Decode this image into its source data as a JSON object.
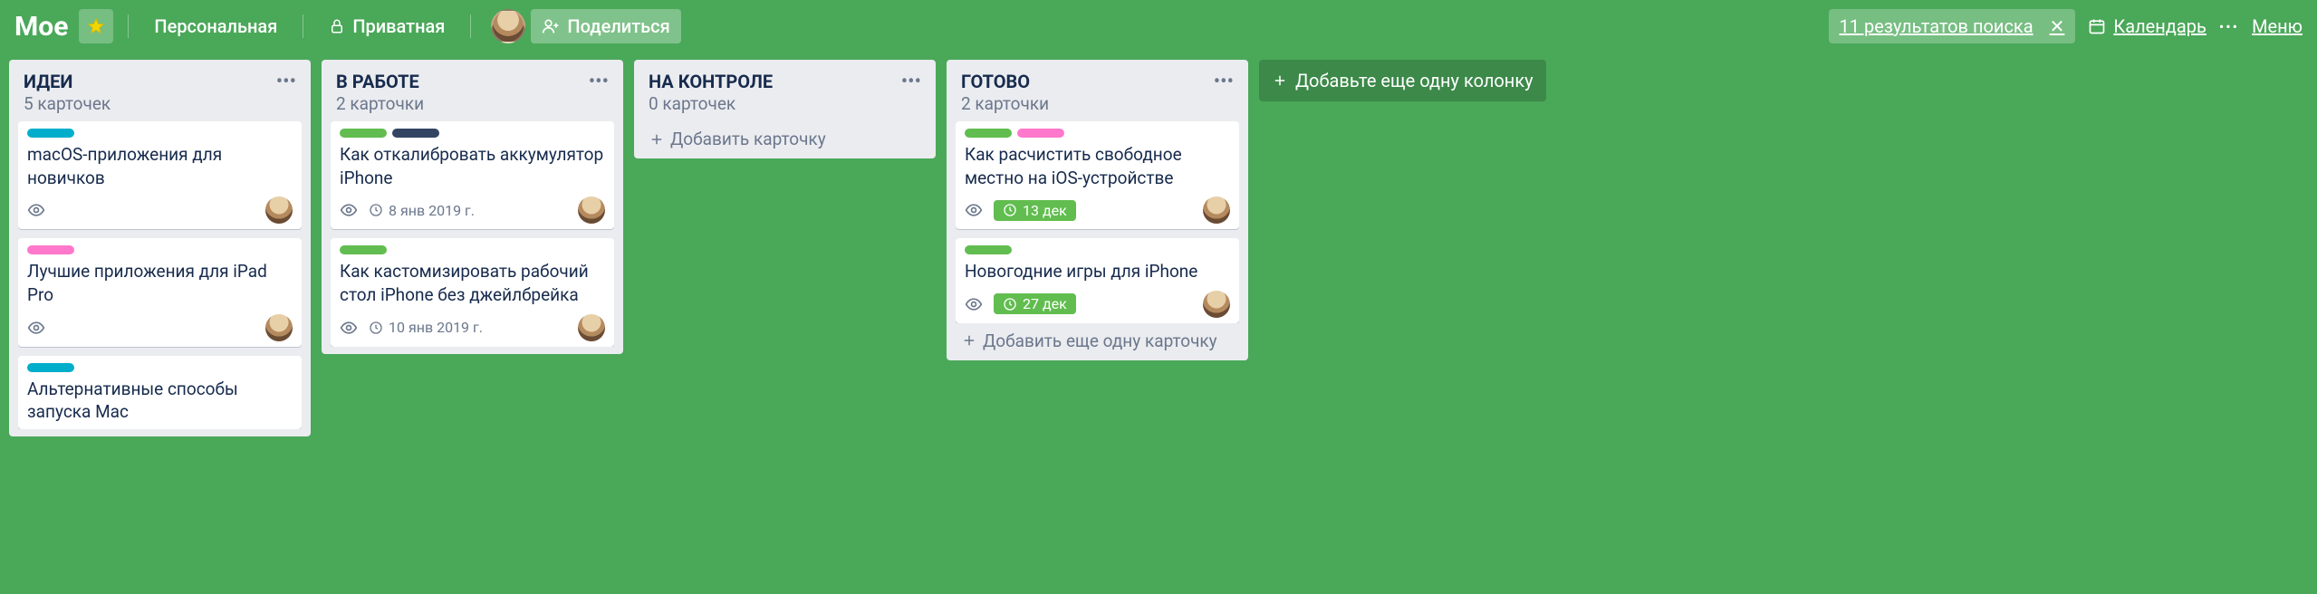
{
  "header": {
    "board_title": "Мое",
    "team_label": "Персональная",
    "visibility_label": "Приватная",
    "share_label": "Поделиться",
    "search_results_label": "11 результатов поиска",
    "calendar_label": "Календарь",
    "menu_label": "Меню"
  },
  "label_colors": {
    "blue": "#00aecc",
    "green": "#61bd4f",
    "pink": "#ff78cb",
    "dark": "#344563"
  },
  "lists": [
    {
      "title": "ИДЕИ",
      "count_label": "5 карточек",
      "add_card_label": "",
      "cards": [
        {
          "labels": [
            "blue"
          ],
          "title": "macOS-приложения для новичков",
          "watch": true,
          "due": null,
          "member": true
        },
        {
          "labels": [
            "pink"
          ],
          "title": "Лучшие приложения для iPad Pro",
          "watch": true,
          "due": null,
          "member": true
        },
        {
          "labels": [
            "blue"
          ],
          "title": "Альтернативные способы запуска Mac",
          "watch": false,
          "due": null,
          "member": false
        }
      ]
    },
    {
      "title": "В РАБОТЕ",
      "count_label": "2 карточки",
      "add_card_label": "",
      "cards": [
        {
          "labels": [
            "green",
            "dark"
          ],
          "title": "Как откалибровать аккумулятор iPhone",
          "watch": true,
          "due": "8 янв 2019 г.",
          "due_style": "plain",
          "member": true
        },
        {
          "labels": [
            "green"
          ],
          "title": "Как кастомизировать рабочий стол iPhone без джейлбрейка",
          "watch": true,
          "due": "10 янв 2019 г.",
          "due_style": "plain",
          "member": true
        }
      ]
    },
    {
      "title": "НА КОНТРОЛЕ",
      "count_label": "0 карточек",
      "add_card_label": "Добавить карточку",
      "cards": []
    },
    {
      "title": "ГОТОВО",
      "count_label": "2 карточки",
      "add_card_label": "Добавить еще одну карточку",
      "cards": [
        {
          "labels": [
            "green",
            "pink"
          ],
          "title": "Как расчистить свободное местно на iOS-устройстве",
          "watch": true,
          "due": "13 дек",
          "due_style": "green",
          "member": true
        },
        {
          "labels": [
            "green"
          ],
          "title": "Новогодние игры для iPhone",
          "watch": true,
          "due": "27 дек",
          "due_style": "green",
          "member": true
        }
      ]
    }
  ],
  "add_list_label": "Добавьте еще одну колонку"
}
